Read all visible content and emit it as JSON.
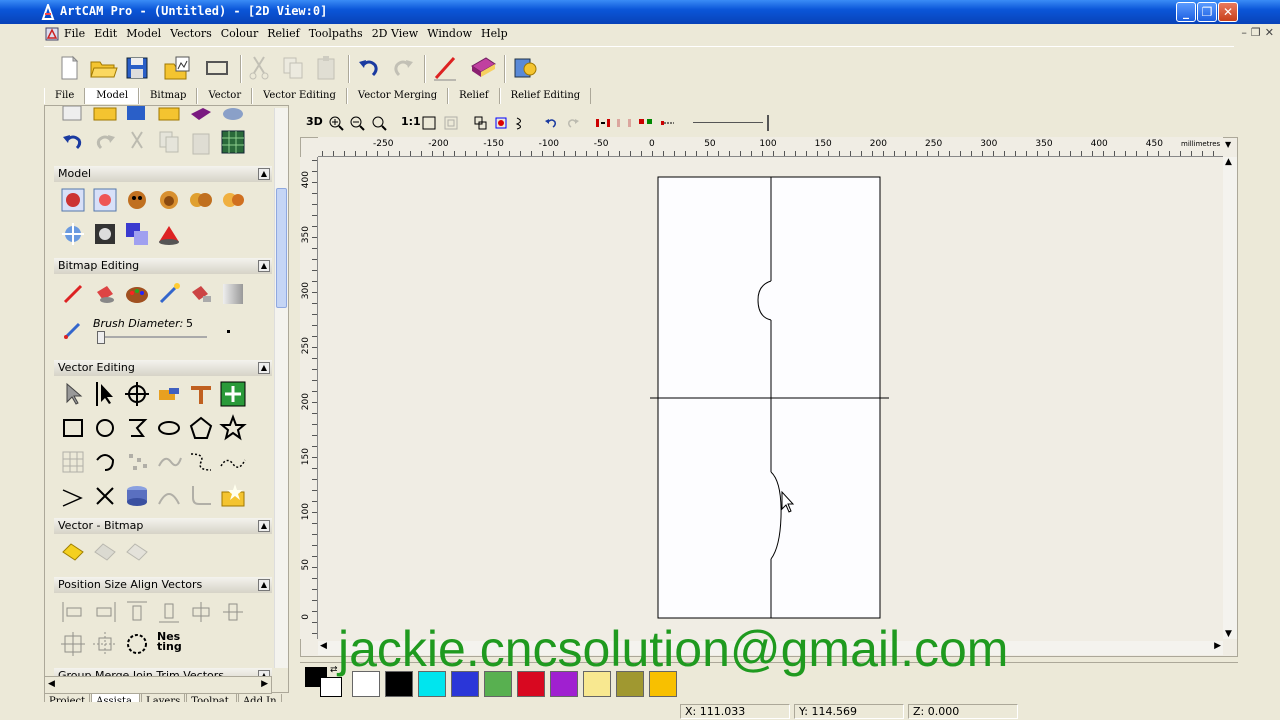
{
  "window": {
    "title": "ArtCAM Pro - (Untitled) - [2D View:0]",
    "minimize": "_",
    "maximize": "❐",
    "close": "✕"
  },
  "menu": [
    "File",
    "Edit",
    "Model",
    "Vectors",
    "Colour",
    "Relief",
    "Toolpaths",
    "2D View",
    "Window",
    "Help"
  ],
  "mdi_controls": [
    "–",
    "❐",
    "✕"
  ],
  "tabs": [
    "File",
    "Model",
    "Bitmap",
    "Vector",
    "Vector Editing",
    "Vector Merging",
    "Relief",
    "Relief Editing"
  ],
  "active_tab": "Model",
  "panel": {
    "sections": [
      {
        "title": "Model"
      },
      {
        "title": "Bitmap Editing"
      },
      {
        "title": "Vector Editing"
      },
      {
        "title": "Vector - Bitmap"
      },
      {
        "title": "Position Size Align Vectors"
      },
      {
        "title": "Group Merge Join Trim Vectors"
      }
    ],
    "brush_label": "Brush Diameter:",
    "brush_value": "5",
    "nesting_label": "Nes ting"
  },
  "left_tabs": [
    "Project",
    "Assista.",
    "Layers",
    "Toolpat.",
    "Add In"
  ],
  "left_active_tab": "Assista.",
  "view_toolbar": {
    "three_d": "3D",
    "one_to_one": "1:1"
  },
  "ruler": {
    "h_labels": [
      "-250",
      "-200",
      "-150",
      "-100",
      "-50",
      "0",
      "50",
      "100",
      "150",
      "200",
      "250",
      "300",
      "350",
      "400",
      "450"
    ],
    "units": "millimetres",
    "v_labels": [
      "400",
      "350",
      "300",
      "250",
      "200",
      "150",
      "100",
      "50",
      "0"
    ]
  },
  "colors": {
    "swatches": [
      "#ffffff",
      "#000000",
      "#00e5ee",
      "#2a36d8",
      "#58b050",
      "#d80820",
      "#a020d0",
      "#f8e890",
      "#a09830",
      "#f8c000"
    ],
    "title_bar": "#0b56d8",
    "watermark": "#1f9a1f"
  },
  "status": {
    "x": "X:  111.033",
    "y": "Y:  114.569",
    "z": "Z:  0.000"
  },
  "watermark": "jackie.cncsolution@gmail.com"
}
